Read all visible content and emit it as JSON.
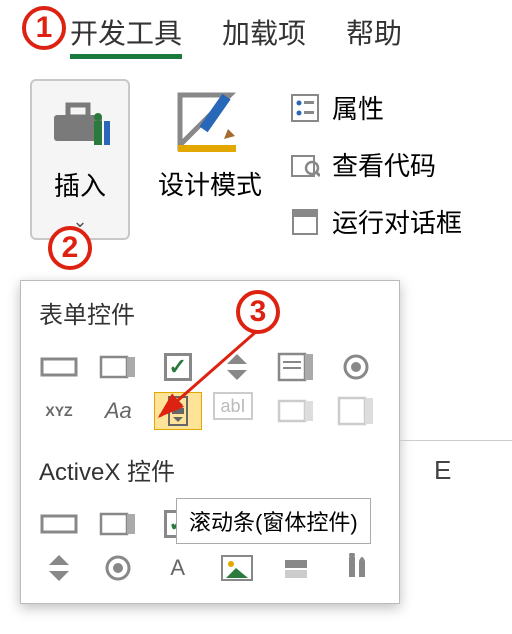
{
  "tabs": {
    "developer": "开发工具",
    "addins": "加载项",
    "help": "帮助"
  },
  "ribbon": {
    "insert": "插入",
    "designMode": "设计模式",
    "properties": "属性",
    "viewCode": "查看代码",
    "runDialog": "运行对话框"
  },
  "popup": {
    "formControls": "表单控件",
    "activeXControls": "ActiveX 控件",
    "iconXYZ": "XYZ",
    "iconAa": "Aa",
    "iconAbl": "abI",
    "iconA": "A"
  },
  "tooltip": "滚动条(窗体控件)",
  "grid": {
    "colE": "E"
  },
  "markers": {
    "m1": "1",
    "m2": "2",
    "m3": "3"
  }
}
